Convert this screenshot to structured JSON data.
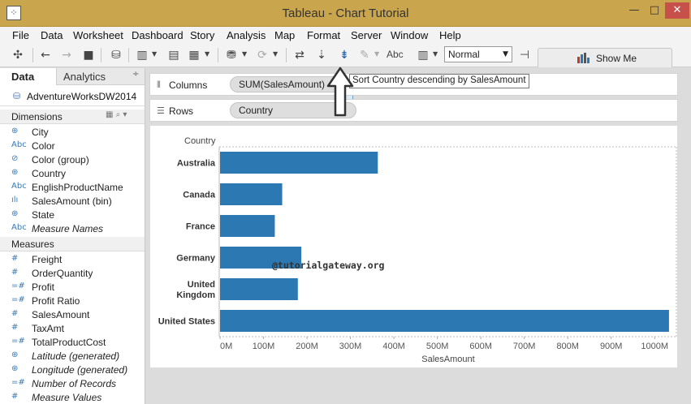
{
  "window": {
    "title": "Tableau - Chart Tutorial",
    "minimize_label": "—",
    "maximize_label": "□",
    "close_label": "✕"
  },
  "menu": [
    "File",
    "Data",
    "Worksheet",
    "Dashboard",
    "Story",
    "Analysis",
    "Map",
    "Format",
    "Server",
    "Window",
    "Help"
  ],
  "toolbar": {
    "fit_value": "Normal",
    "text_button": "Abc",
    "show_me_label": "Show Me",
    "tooltip": "Sort Country descending by SalesAmount"
  },
  "data_pane": {
    "tabs": [
      "Data",
      "Analytics"
    ],
    "datasource": "AdventureWorksDW2014",
    "dimensions_header": "Dimensions",
    "measures_header": "Measures",
    "dimensions": [
      {
        "icon": "globe-icon",
        "glyph": "⊕",
        "name": "City",
        "italic": false
      },
      {
        "icon": "abc-icon",
        "glyph": "Abc",
        "name": "Color",
        "italic": false
      },
      {
        "icon": "paperclip-icon",
        "glyph": "⊘",
        "name": "Color (group)",
        "italic": false
      },
      {
        "icon": "globe-icon",
        "glyph": "⊕",
        "name": "Country",
        "italic": false
      },
      {
        "icon": "abc-icon",
        "glyph": "Abc",
        "name": "EnglishProductName",
        "italic": false
      },
      {
        "icon": "bin-icon",
        "glyph": "ılı",
        "name": "SalesAmount (bin)",
        "italic": false
      },
      {
        "icon": "globe-icon",
        "glyph": "⊕",
        "name": "State",
        "italic": false
      },
      {
        "icon": "abc-icon",
        "glyph": "Abc",
        "name": "Measure Names",
        "italic": true
      }
    ],
    "measures": [
      {
        "icon": "hash-icon",
        "glyph": "#",
        "name": "Freight",
        "italic": false
      },
      {
        "icon": "hash-icon",
        "glyph": "#",
        "name": "OrderQuantity",
        "italic": false
      },
      {
        "icon": "calc-hash-icon",
        "glyph": "=#",
        "name": "Profit",
        "italic": false
      },
      {
        "icon": "calc-hash-icon",
        "glyph": "=#",
        "name": "Profit Ratio",
        "italic": false
      },
      {
        "icon": "hash-icon",
        "glyph": "#",
        "name": "SalesAmount",
        "italic": false
      },
      {
        "icon": "hash-icon",
        "glyph": "#",
        "name": "TaxAmt",
        "italic": false
      },
      {
        "icon": "calc-hash-icon",
        "glyph": "=#",
        "name": "TotalProductCost",
        "italic": false
      },
      {
        "icon": "globe-icon",
        "glyph": "⊕",
        "name": "Latitude (generated)",
        "italic": true
      },
      {
        "icon": "globe-icon",
        "glyph": "⊕",
        "name": "Longitude (generated)",
        "italic": true
      },
      {
        "icon": "calc-hash-icon",
        "glyph": "=#",
        "name": "Number of Records",
        "italic": true
      },
      {
        "icon": "hash-icon",
        "glyph": "#",
        "name": "Measure Values",
        "italic": true
      }
    ]
  },
  "shelves": {
    "columns_label": "Columns",
    "columns_pill": "SUM(SalesAmount)",
    "rows_label": "Rows",
    "rows_pill": "Country"
  },
  "watermark": "@tutorialgateway.org",
  "colors": {
    "bar": "#2b78b3",
    "titlebar": "#c9a54d"
  },
  "chart_data": {
    "type": "bar",
    "orientation": "horizontal",
    "row_header": "Country",
    "categories": [
      "Australia",
      "Canada",
      "France",
      "Germany",
      "United Kingdom",
      "United States"
    ],
    "category_labels": [
      [
        "Australia"
      ],
      [
        "Canada"
      ],
      [
        "France"
      ],
      [
        "Germany"
      ],
      [
        "United",
        "Kingdom"
      ],
      [
        "United States"
      ]
    ],
    "values": [
      363000000,
      143000000,
      126000000,
      187000000,
      179000000,
      1033000000
    ],
    "xlabel": "SalesAmount",
    "ticks": [
      0,
      100000000,
      200000000,
      300000000,
      400000000,
      500000000,
      600000000,
      700000000,
      800000000,
      900000000,
      1000000000
    ],
    "tick_labels": [
      "0M",
      "100M",
      "200M",
      "300M",
      "400M",
      "500M",
      "600M",
      "700M",
      "800M",
      "900M",
      "1000M"
    ],
    "xlim": [
      0,
      1050000000
    ],
    "grid": false
  }
}
